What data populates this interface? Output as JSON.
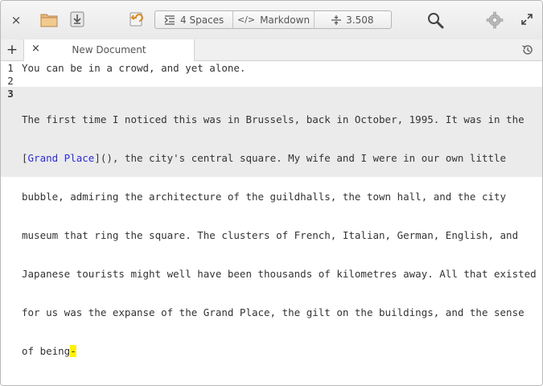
{
  "window": {
    "close_label": "×"
  },
  "toolbar": {
    "indent_label": "4 Spaces",
    "syntax_label": "Markdown",
    "syntax_icon": "</>",
    "zoom_label": "3.508"
  },
  "tabs": {
    "new_label": "+",
    "close_label": "×",
    "items": [
      {
        "label": "New Document"
      }
    ]
  },
  "editor": {
    "lines": [
      {
        "number": "1",
        "text": "You can be in a crowd, and yet alone."
      },
      {
        "number": "2",
        "text": ""
      },
      {
        "number": "3",
        "pre": "The first time I noticed this was in Brussels, back in October, 1995. It was in the",
        "bracket_open": "[",
        "link_text": "Grand Place",
        "after_link": "](), the city's central square. My wife and I were in our own little",
        "rest": [
          "bubble, admiring the architecture of the guildhalls, the town hall, and the city",
          "museum that ring the square. The clusters of French, Italian, German, English, and",
          "Japanese tourists might well have been thousands of kilometres away. All that existed",
          "for us was the expanse of the Grand Place, the gilt on the buildings, and the sense"
        ],
        "last": "of being",
        "cursor_char": "-"
      }
    ]
  }
}
